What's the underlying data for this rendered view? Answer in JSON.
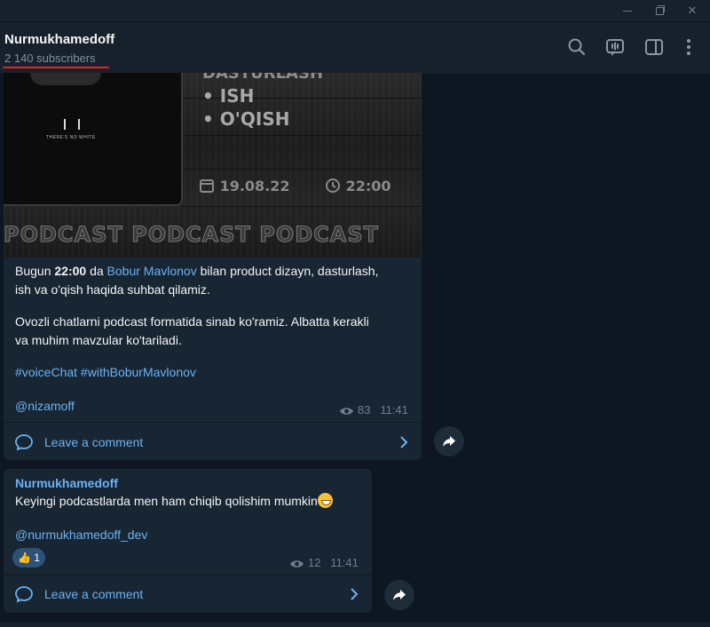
{
  "window": {
    "controls": {
      "minimize_icon": "minimize-icon",
      "maximize_icon": "restore-icon",
      "close_label": "✕"
    }
  },
  "header": {
    "channel_name": "Nurmukhamedoff",
    "subscribers": "2 140 subscribers",
    "icons": [
      "search-icon",
      "voice-chat-icon",
      "sidebar-toggle-icon",
      "more-icon"
    ]
  },
  "messages": [
    {
      "image": {
        "top_text": "DASTURLASH",
        "line1": "• ISH",
        "line2": "• O'QISH",
        "date": "19.08.22",
        "time": "22:00",
        "banner": "PODCAST  PODCAST  PODCAST"
      },
      "text": {
        "p1_a": "Bugun ",
        "p1_time": "22:00",
        "p1_b": " da ",
        "p1_link": "Bobur Mavlonov",
        "p1_c": " bilan product dizayn, dasturlash,",
        "p1_d": "ish va o'qish haqida suhbat qilamiz.",
        "p2_a": "Ovozli chatlarni podcast formatida sinab ko'ramiz. Albatta kerakli",
        "p2_b": "va muhim mavzular ko'tariladi.",
        "hashtags": "#voiceChat #withBoburMavlonov",
        "mention": "@nizamoff"
      },
      "views": "83",
      "time": "11:41",
      "comment_label": "Leave a comment"
    },
    {
      "sender": "Nurmukhamedoff",
      "text": "Keyingi podcastlarda men ham chiqib qolishim mumkin",
      "mention": "@nurmukhamedoff_dev",
      "reaction": {
        "emoji": "👍",
        "count": "1"
      },
      "views": "12",
      "time": "11:41",
      "comment_label": "Leave a comment"
    }
  ],
  "colors": {
    "background": "#0e1621",
    "bubble": "#182533",
    "header": "#17212b",
    "link": "#6ab3f3",
    "meta": "#6d7f8f",
    "underline": "#d42a2a"
  }
}
